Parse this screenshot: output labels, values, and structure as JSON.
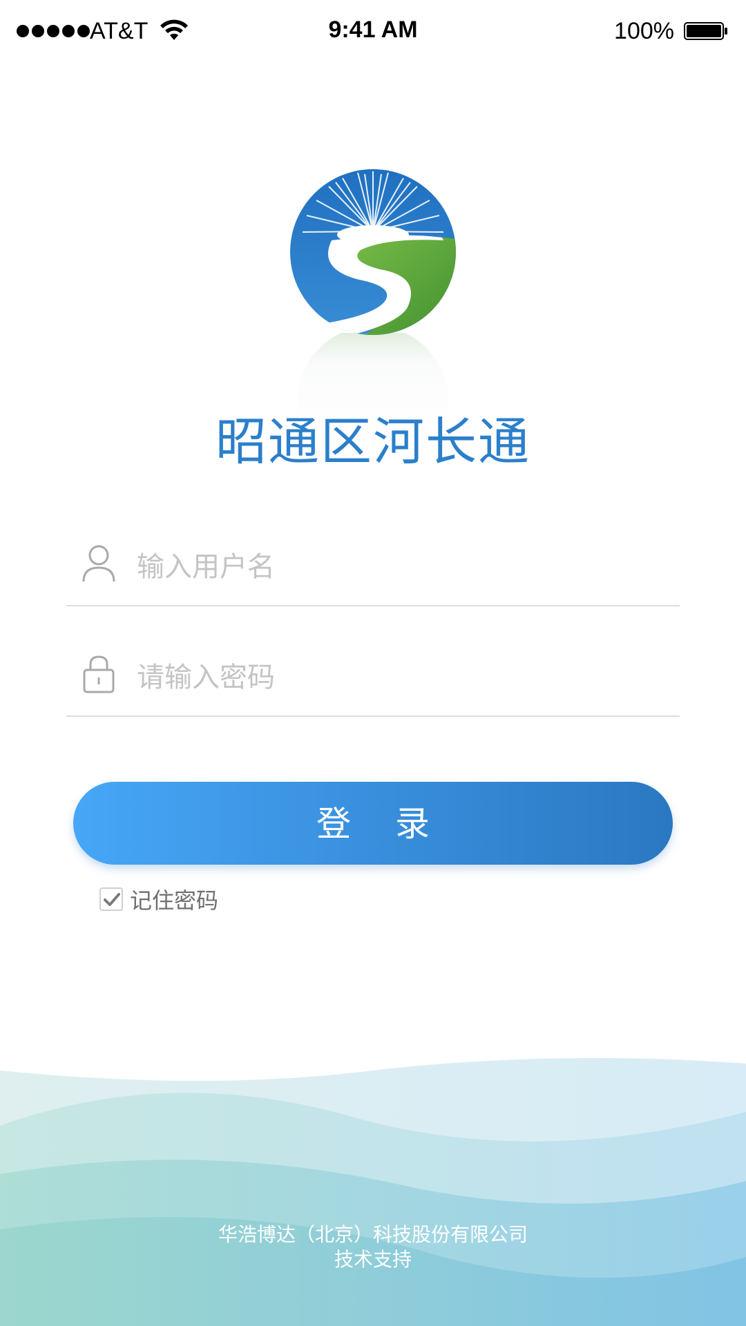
{
  "status_bar": {
    "carrier": "AT&T",
    "time": "9:41 AM",
    "battery": "100%",
    "icons": [
      "signal-dots-icon",
      "wifi-icon",
      "battery-icon"
    ]
  },
  "app": {
    "title": "昭通区河长通",
    "logo": "river-sun-logo"
  },
  "login_form": {
    "username_placeholder": "输入用户名",
    "username_icon": "user-icon",
    "password_placeholder": "请输入密码",
    "password_icon": "lock-icon",
    "login_label": "登 录",
    "remember_label": "记住密码",
    "remember_checked": true
  },
  "footer": {
    "line1": "华浩博达（北京）科技股份有限公司",
    "line2": "技术支持"
  },
  "colors": {
    "brand_blue": "#2b7fcb",
    "button_start": "#47a6f7",
    "button_end": "#2b78c2",
    "logo_green": "#5aa53c"
  }
}
